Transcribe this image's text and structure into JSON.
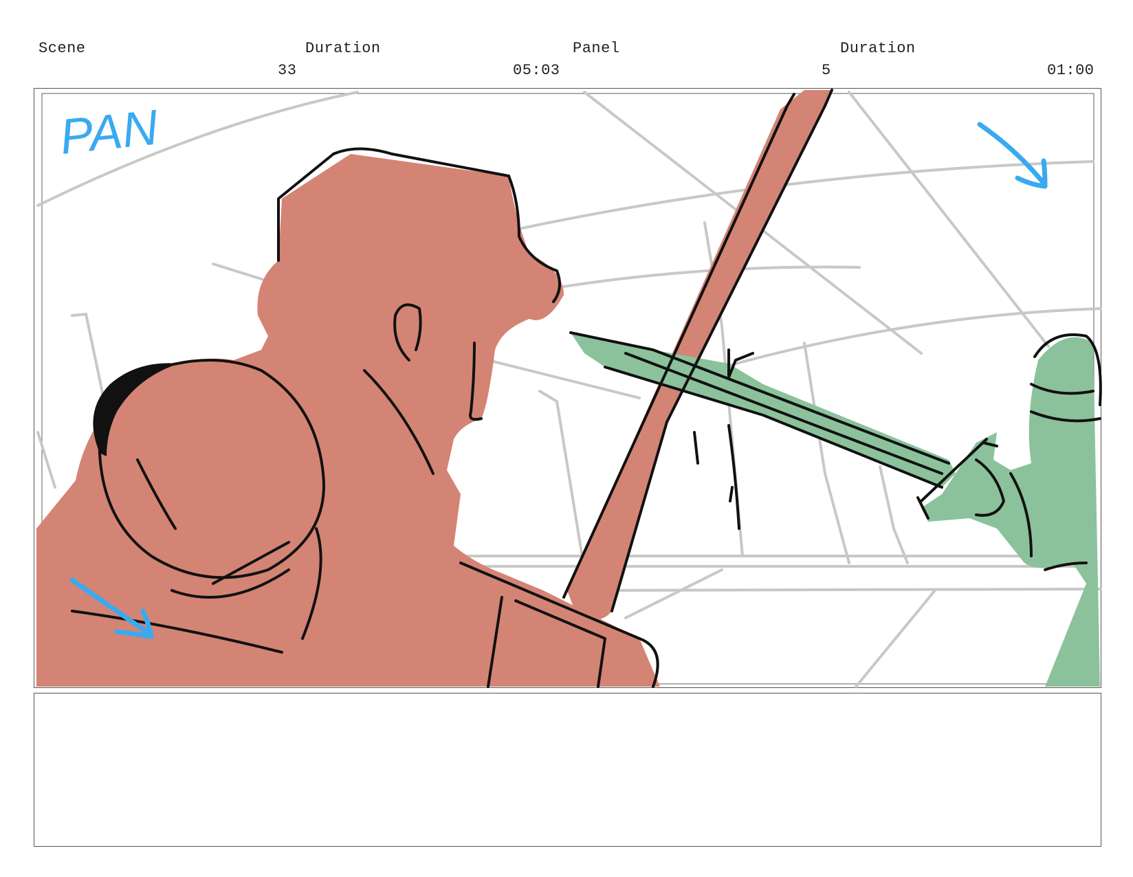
{
  "header": {
    "scene_label": "Scene",
    "scene_value": "33",
    "scene_duration_label": "Duration",
    "scene_duration_value": "05:03",
    "panel_label": "Panel",
    "panel_value": "5",
    "panel_duration_label": "Duration",
    "panel_duration_value": "01:00"
  },
  "panel": {
    "annotation_text": "PAN",
    "annotation_color": "#3aaaf0",
    "character_left_color": "#d48474",
    "character_right_color": "#8bc29b",
    "background_line_color": "#c8c8c8",
    "ink_color": "#111111",
    "icons": [
      "pan-arrow-top-right-icon",
      "pan-arrow-bottom-left-icon"
    ]
  },
  "notes": {
    "text": ""
  }
}
